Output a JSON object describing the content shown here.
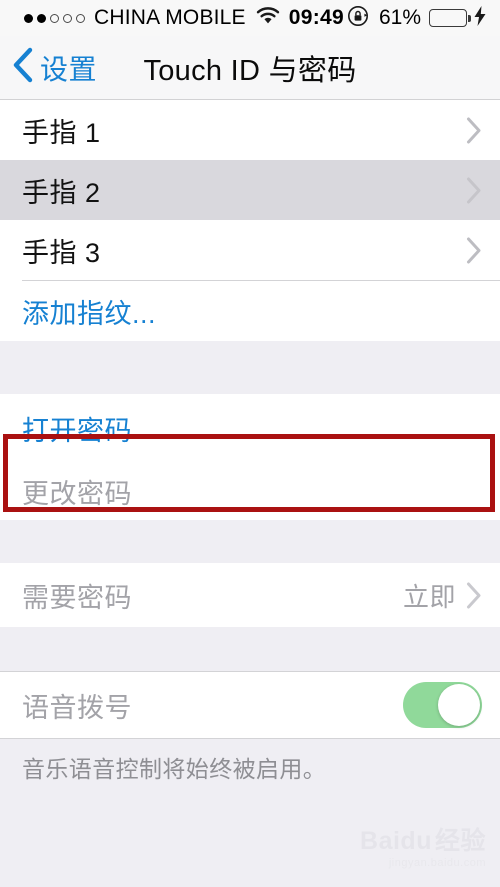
{
  "status_bar": {
    "signal_dots_filled": 2,
    "signal_dots_total": 5,
    "carrier": "CHINA MOBILE",
    "wifi_icon": "wifi-icon",
    "time": "09:49",
    "rotation_lock_icon": "rotation-lock-icon",
    "battery_percent_label": "61%",
    "battery_level": 61,
    "battery_color": "#4CD964",
    "charging_icon": "lightning-bolt-icon"
  },
  "nav_bar": {
    "back_icon": "chevron-left-icon",
    "back_label": "设置",
    "title": "Touch ID 与密码",
    "tint_color": "#1681D2"
  },
  "sections": {
    "fingerprints": {
      "rows": [
        {
          "label": "手指 1",
          "chevron": true,
          "pressed": false
        },
        {
          "label": "手指 2",
          "chevron": true,
          "pressed": true
        },
        {
          "label": "手指 3",
          "chevron": true,
          "pressed": false
        }
      ],
      "add_row": {
        "label": "添加指纹...",
        "style": "link"
      }
    },
    "passcode": {
      "turn_on": {
        "label": "打开密码",
        "style": "link"
      },
      "change": {
        "label": "更改密码",
        "style": "disabled"
      }
    },
    "require_passcode": {
      "label": "需要密码",
      "value": "立即",
      "chevron": true,
      "style": "disabled"
    },
    "voice_dial": {
      "label": "语音拨号",
      "toggle_on": true,
      "toggle_color": "#90D99A",
      "footer": "音乐语音控制将始终被启用。"
    }
  },
  "annotation": {
    "shape": "rectangle-highlight",
    "color": "#AA1111",
    "targets": "打开密码"
  },
  "watermark": {
    "brand": "Baidu",
    "suffix": "经验",
    "url": "jingyan.baidu.com"
  }
}
